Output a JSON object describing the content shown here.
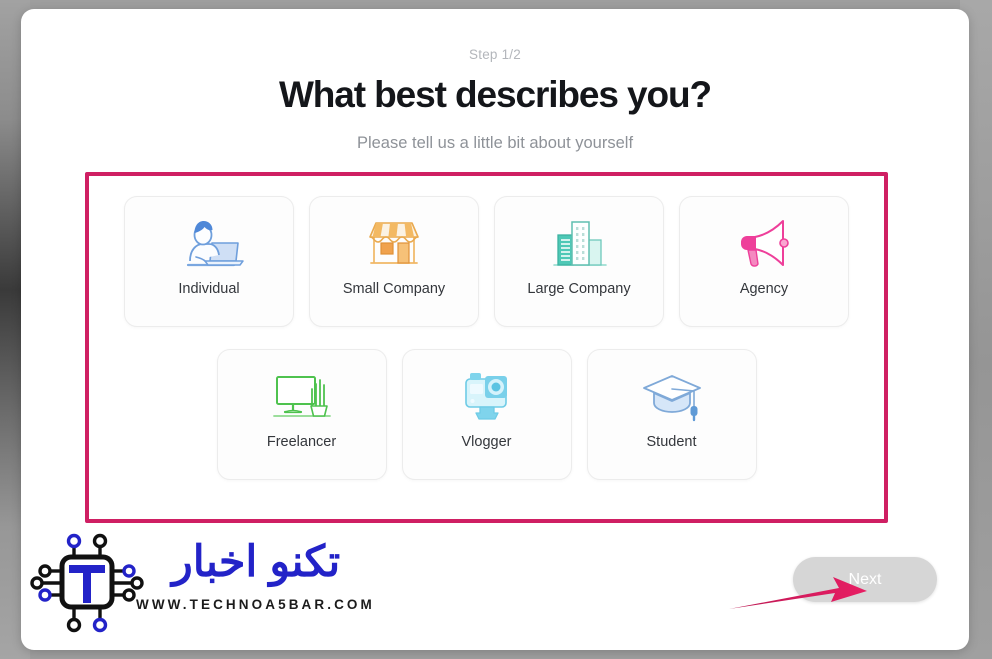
{
  "window": {
    "background_color": "#9e9e9e",
    "card_background": "#ffffff"
  },
  "header": {
    "step_label": "Step 1/2",
    "title": "What best describes you?",
    "subtitle": "Please tell us a little bit about yourself"
  },
  "annotation": {
    "highlight_box_color": "#cf1f63",
    "arrow_color": "#d61b5e",
    "arrow_target": "next-button"
  },
  "options": {
    "row1": [
      {
        "id": "individual",
        "label": "Individual",
        "icon": "person-laptop-icon",
        "color": "#5b8dd6"
      },
      {
        "id": "small-company",
        "label": "Small Company",
        "icon": "shop-storefront-icon",
        "color": "#eeac52"
      },
      {
        "id": "large-company",
        "label": "Large Company",
        "icon": "office-buildings-icon",
        "color": "#4cc8b4"
      },
      {
        "id": "agency",
        "label": "Agency",
        "icon": "megaphone-icon",
        "color": "#ee3f9a"
      }
    ],
    "row2": [
      {
        "id": "freelancer",
        "label": "Freelancer",
        "icon": "monitor-plant-icon",
        "color": "#4ec24e"
      },
      {
        "id": "vlogger",
        "label": "Vlogger",
        "icon": "action-camera-icon",
        "color": "#5ecbe8"
      },
      {
        "id": "student",
        "label": "Student",
        "icon": "graduation-cap-icon",
        "color": "#93b6dd"
      }
    ]
  },
  "footer": {
    "next_label": "Next",
    "next_enabled": false
  },
  "watermark": {
    "brand_ar": "تکنو اخبار",
    "url": "WWW.TECHNOA5BAR.COM",
    "logo_letter": "T",
    "logo_color": "#2323c8"
  }
}
